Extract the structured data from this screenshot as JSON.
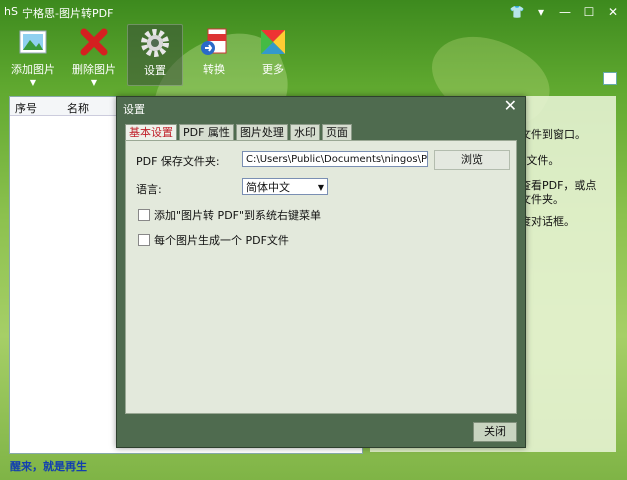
{
  "window": {
    "logo_text": "hS",
    "title": "宁格思-图片转PDF",
    "controls": [
      "shirt-icon",
      "menu-icon",
      "minimize-icon",
      "maximize-icon",
      "close-icon"
    ]
  },
  "toolbar": {
    "add_label": "添加图片",
    "delete_label": "删除图片",
    "settings_label": "设置",
    "convert_label": "转换",
    "more_label": "更多"
  },
  "list": {
    "col_index": "序号",
    "col_name": "名称"
  },
  "help": {
    "line1": "文件到窗口。",
    "line2": "F文件。",
    "line3": "查看PDF，或点",
    "line4": "文件夹。",
    "line5": "度对话框。"
  },
  "status": {
    "text": "醒来，就是再生"
  },
  "dialog": {
    "title": "设置",
    "close_x": "✕",
    "tabs": [
      "基本设置",
      "PDF 属性",
      "图片处理",
      "水印",
      "页面"
    ],
    "save_folder_label": "PDF 保存文件夹:",
    "save_folder_value": "C:\\Users\\Public\\Documents\\ningos\\PDF",
    "browse_label": "浏览",
    "language_label": "语言:",
    "language_value": "简体中文",
    "option_context_menu": "添加\"图片转 PDF\"到系统右键菜单",
    "option_per_image": "每个图片生成一个 PDF文件",
    "close_label": "关闭"
  }
}
